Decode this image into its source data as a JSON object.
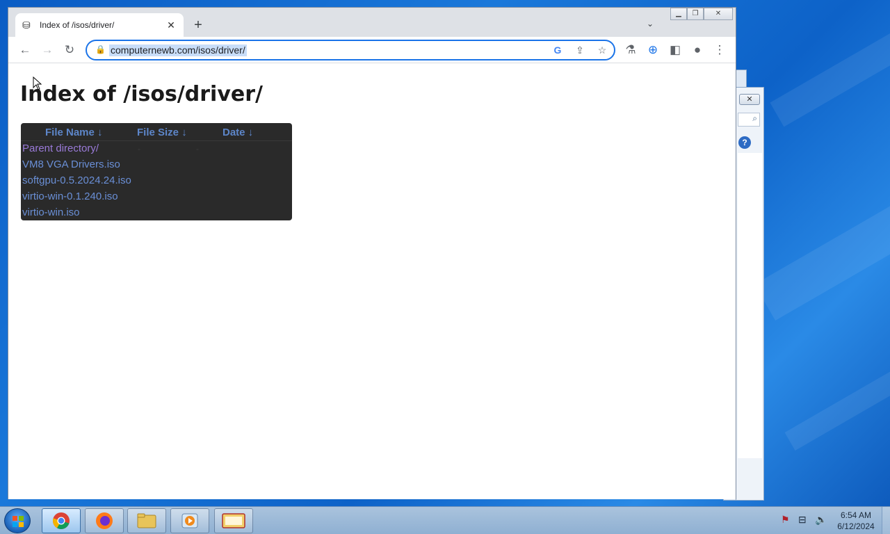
{
  "browser": {
    "tab": {
      "title": "Index of /isos/driver/",
      "favicon": "server-icon"
    },
    "address": {
      "url": "computernewb.com/isos/driver/"
    }
  },
  "page": {
    "heading": "Index of /isos/driver/",
    "table": {
      "columns": [
        "File Name  ↓",
        "File Size  ↓",
        "Date  ↓"
      ],
      "rows": [
        {
          "name": "Parent directory/",
          "size": "-",
          "date": "-"
        },
        {
          "name": "VM8 VGA Drivers.iso",
          "size": "",
          "date": ""
        },
        {
          "name": "softgpu-0.5.2024.24.iso",
          "size": "",
          "date": ""
        },
        {
          "name": "virtio-win-0.1.240.iso",
          "size": "",
          "date": ""
        },
        {
          "name": "virtio-win.iso",
          "size": "",
          "date": ""
        }
      ]
    }
  },
  "taskbar": {
    "clock": {
      "time": "6:54 AM",
      "date": "6/12/2024"
    }
  },
  "colors": {
    "accent": "#1a73e8",
    "table_bg": "#2a2a2a",
    "link": "#6a8fd6",
    "visited_link": "#9a7ad8"
  }
}
